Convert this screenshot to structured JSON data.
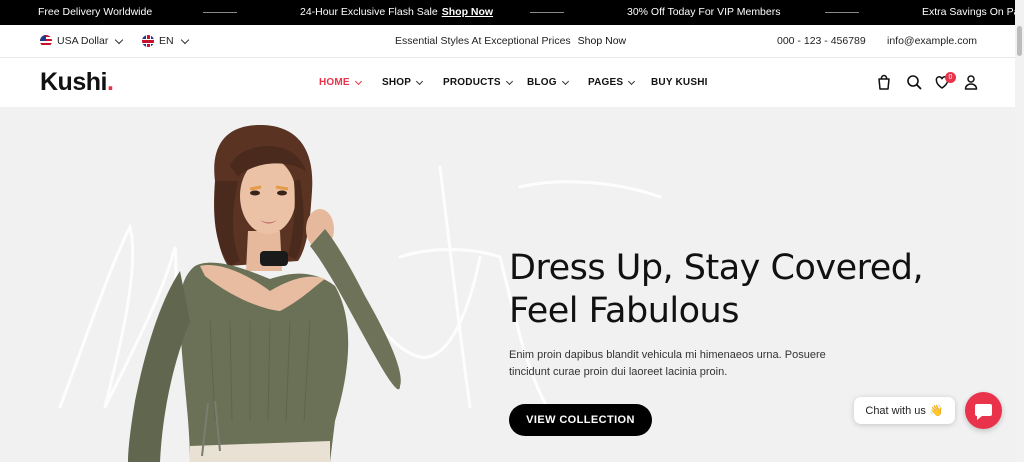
{
  "announcement": {
    "msg1": "Free Delivery Worldwide",
    "msg2": "24-Hour Exclusive Flash Sale",
    "msg2_link": "Shop Now",
    "msg3": "30% Off Today For VIP Members",
    "msg4": "Extra Savings On Party"
  },
  "inforow": {
    "currency": "USA Dollar",
    "language": "EN",
    "promo": "Essential Styles At Exceptional Prices",
    "promo_link": "Shop Now",
    "phone": "000 - 123 - 456789",
    "email": "info@example.com"
  },
  "header": {
    "logo": "Kushi",
    "logo_dot": ".",
    "nav": [
      {
        "label": "HOME",
        "active": true
      },
      {
        "label": "SHOP"
      },
      {
        "label": "PRODUCTS"
      },
      {
        "label": "BLOG"
      },
      {
        "label": "PAGES"
      },
      {
        "label": "BUY KUSHI"
      }
    ],
    "wishlist_count": "0"
  },
  "hero": {
    "headline_line1": "Dress Up, Stay Covered,",
    "headline_line2": "Feel Fabulous",
    "subtext": "Enim proin dapibus blandit vehicula mi himenaeos urna. Posuere tincidunt curae proin dui laoreet lacinia proin.",
    "cta": "VIEW COLLECTION"
  },
  "chat": {
    "label": "Chat with us",
    "emoji": "👋"
  },
  "colors": {
    "accent": "#e8334a",
    "hero_bg": "#f1f1f1",
    "topbar_bg": "#000000"
  },
  "icons": [
    "bag-icon",
    "search-icon",
    "heart-icon",
    "user-icon",
    "chat-icon",
    "chevron-down-icon"
  ]
}
